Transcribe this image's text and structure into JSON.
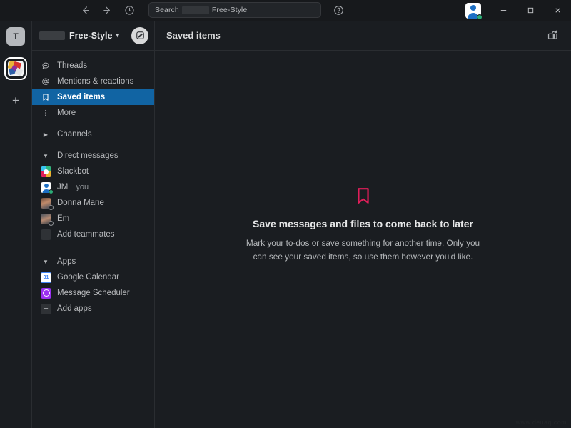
{
  "titlebar": {
    "menu_icon": "hamburger-icon",
    "back_icon": "arrow-left-icon",
    "forward_icon": "arrow-right-icon",
    "history_icon": "clock-icon",
    "search": {
      "prefix_label": "Search",
      "redacted": true,
      "workspace_label": "Free-Style",
      "placeholder": "Search Free-Style"
    },
    "help_icon": "question-circle-icon",
    "avatar_icon": "user-avatar-icon",
    "presence": "online",
    "minimize_label": "–",
    "maximize_label": "□",
    "close_label": "✕"
  },
  "rail": {
    "profile_initial": "T",
    "workspace_icon_name": "workspace-logo-icon",
    "add_workspace_label": "+"
  },
  "sidebar": {
    "workspace": {
      "redacted_prefix": true,
      "name": "Free-Style",
      "chevron": "▾",
      "compose_icon": "compose-pencil-icon"
    },
    "nav": [
      {
        "label": "Threads",
        "icon": "threads-icon",
        "selected": false
      },
      {
        "label": "Mentions & reactions",
        "icon": "at-icon",
        "selected": false
      },
      {
        "label": "Saved items",
        "icon": "bookmark-icon",
        "selected": true
      },
      {
        "label": "More",
        "icon": "more-vertical-icon",
        "selected": false
      }
    ],
    "sections": [
      {
        "label": "Channels",
        "expanded": false,
        "arrow": "▶",
        "items": []
      },
      {
        "label": "Direct messages",
        "expanded": true,
        "arrow": "▼",
        "items": [
          {
            "label": "Slackbot",
            "avatar": "slackbot-avatar",
            "presence": "none",
            "suffix": ""
          },
          {
            "label": "JM",
            "avatar": "person-avatar",
            "presence": "online",
            "suffix": "you"
          },
          {
            "label": "Donna Marie",
            "avatar": "photo-avatar-1",
            "presence": "away",
            "suffix": ""
          },
          {
            "label": "Em",
            "avatar": "photo-avatar-2",
            "presence": "away",
            "suffix": ""
          },
          {
            "label": "Add teammates",
            "avatar": "plus-tile",
            "presence": "none",
            "suffix": ""
          }
        ]
      },
      {
        "label": "Apps",
        "expanded": true,
        "arrow": "▼",
        "items": [
          {
            "label": "Google Calendar",
            "avatar": "google-calendar-icon",
            "presence": "none",
            "badge": "31",
            "suffix": ""
          },
          {
            "label": "Message Scheduler",
            "avatar": "message-scheduler-icon",
            "presence": "none",
            "suffix": ""
          },
          {
            "label": "Add apps",
            "avatar": "plus-tile",
            "presence": "none",
            "suffix": ""
          }
        ]
      }
    ]
  },
  "main": {
    "title": "Saved items",
    "split_view_icon": "open-split-view-icon",
    "empty_state": {
      "icon": "bookmark-icon",
      "icon_color": "#e01e5a",
      "title": "Save messages and files to come back to later",
      "description": "Mark your to-dos or save something for another time. Only you can see your saved items, so use them however you'd like."
    }
  },
  "watermark": "www.deuaq.com",
  "colors": {
    "app_bg": "#1a1d21",
    "titlebar_bg": "#17191c",
    "selected_blue": "#1164a3",
    "accent_crimson": "#e01e5a",
    "online_green": "#2bac76"
  }
}
